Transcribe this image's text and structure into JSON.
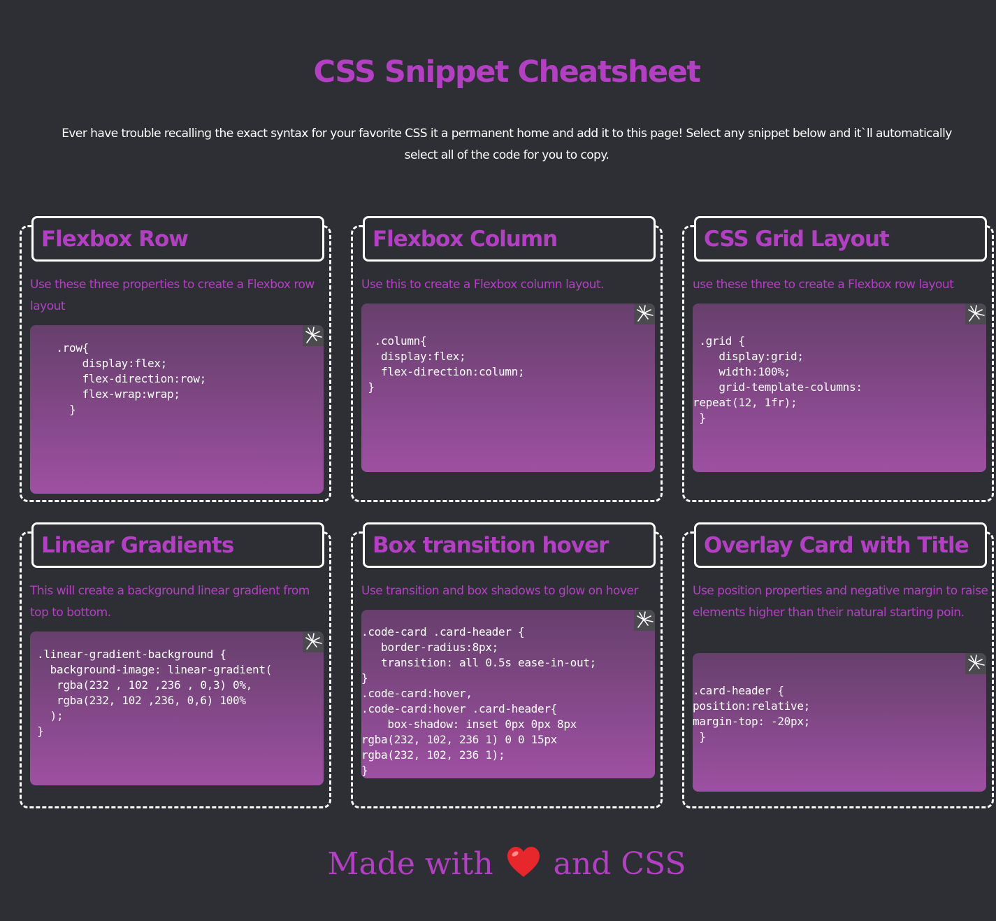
{
  "header": {
    "title": "CSS Snippet Cheatsheet",
    "intro": "Ever have trouble recalling the exact syntax for your favorite CSS it a permanent home and add it to this page! Select any snippet below and it`ll automatically select all of the code for you to copy."
  },
  "cards": [
    {
      "title": "Flexbox Row",
      "description": "Use these three properties to create a Flexbox row layout",
      "code": "    .row{\n        display:flex;\n        flex-direction:row;\n        flex-wrap:wrap;\n      }",
      "copy_icon": "copy-icon"
    },
    {
      "title": "Flexbox Column",
      "description": "Use this to create a Flexbox column layout.",
      "code": "  .column{\n   display:flex;\n   flex-direction:column;\n }",
      "copy_icon": "copy-icon"
    },
    {
      "title": "CSS Grid Layout",
      "description": "use these three to create a Flexbox row layout",
      "code": " .grid {\n    display:grid;\n    width:100%;\n    grid-template-columns:\nrepeat(12, 1fr);\n }",
      "copy_icon": "copy-icon"
    },
    {
      "title": "Linear Gradients",
      "description": "This will create a background linear gradient from top to bottom.",
      "code": ".linear-gradient-background {\n  background-image: linear-gradient(\n   rgba(232 , 102 ,236 , 0,3) 0%,\n   rgba(232, 102 ,236, 0,6) 100%\n  );\n}",
      "copy_icon": "copy-icon"
    },
    {
      "title": "Box transition hover",
      "description": "Use transition and box shadows to glow on hover",
      "code": ".code-card .card-header {\n   border-radius:8px;\n   transition: all 0.5s ease-in-out;\n}\n.code-card:hover,\n.code-card:hover .card-header{\n    box-shadow: inset 0px 0px 8px\nrgba(232, 102, 236 1) 0 0 15px\nrgba(232, 102, 236 1);\n}",
      "copy_icon": "copy-icon"
    },
    {
      "title": "Overlay Card with Title",
      "description": "Use position properties and negative margin to raise elements higher than their natural starting poin.",
      "code": ".card-header {\nposition:relative;\nmargin-top: -20px;\n }",
      "copy_icon": "copy-icon"
    }
  ],
  "footer": {
    "before": "Made with",
    "after": "and CSS",
    "heart_icon": "heart-icon"
  },
  "colors": {
    "background": "#2e2f34",
    "accent": "#b340c3",
    "text": "#ffffff",
    "heart": "#e8272d"
  }
}
